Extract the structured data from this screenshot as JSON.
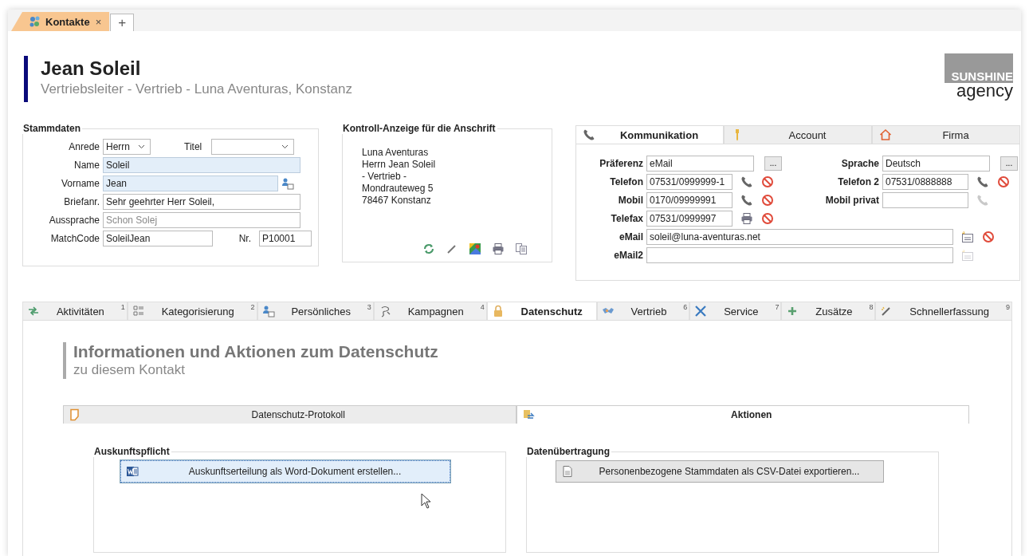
{
  "doc_tabs": [
    {
      "label": "Kontakte",
      "close": "×",
      "selected": true
    }
  ],
  "new_tab": "+",
  "header": {
    "name": "Jean Soleil",
    "subtitle": "Vertriebsleiter - Vertrieb - Luna Aventuras, Konstanz"
  },
  "logo": {
    "line1": "SUNSHINE",
    "line2": "agency"
  },
  "stammdaten": {
    "title": "Stammdaten",
    "rows": [
      [
        {
          "label": "Anrede",
          "value": "Herrn",
          "kind": "select",
          "required": false
        },
        {
          "label": "Titel",
          "kind": "select-wide",
          "required": false
        }
      ],
      [
        {
          "label": "Name",
          "value": "Soleil",
          "kind": "text",
          "required": true
        }
      ],
      [
        {
          "label": "Vorname",
          "value": "Jean",
          "kind": "with-card",
          "required": true
        }
      ],
      [
        {
          "label": "Briefanr.",
          "value": "Sehr geehrter Herr Soleil,",
          "kind": "text",
          "required": false
        }
      ],
      [
        {
          "label": "Aussprache",
          "placeholder": "Schon Solej",
          "kind": "text",
          "required": false
        }
      ],
      [
        {
          "label": "MatchCode",
          "value": "SoleilJean",
          "kind": "short",
          "required": false
        },
        {
          "label": "Nr.",
          "value": "P10001",
          "kind": "tiny",
          "required": false
        }
      ]
    ]
  },
  "anschrift": {
    "title": "Kontroll-Anzeige für die Anschrift",
    "lines": [
      "Luna Aventuras",
      "Herrn Jean Soleil",
      "- Vertrieb -",
      "Mondrauteweg 5",
      "78467 Konstanz"
    ]
  },
  "kommunikation": {
    "tabs": [
      {
        "label": "Kommunikation",
        "selected": true
      },
      {
        "label": "Account",
        "selected": false
      },
      {
        "label": "Firma",
        "selected": false
      }
    ],
    "rows": [
      [
        {
          "label": "Präferenz",
          "value": "eMail",
          "kind": "choice",
          "button": "..."
        },
        {
          "label": "Sprache",
          "value": "Deutsch",
          "kind": "choice",
          "button": "..."
        }
      ],
      [
        {
          "label": "Telefon",
          "value": "07531/0999999-1",
          "kind": "phone",
          "enabled": true
        },
        {
          "label": "Telefon 2",
          "value": "07531/0888888",
          "kind": "phone",
          "enabled": true
        }
      ],
      [
        {
          "label": "Mobil",
          "value": "0170/09999991",
          "kind": "phone",
          "enabled": true
        },
        {
          "label": "Mobil privat",
          "kind": "phone",
          "enabled": false
        }
      ],
      [
        {
          "label": "Telefax",
          "value": "07531/0999997",
          "kind": "fax",
          "enabled": true
        }
      ],
      [
        {
          "label": "eMail",
          "value": "soleil@luna-aventuras.net",
          "kind": "email",
          "enabled": true
        }
      ],
      [
        {
          "label": "eMail2",
          "kind": "email",
          "enabled": false
        }
      ]
    ]
  },
  "section_tabs": [
    {
      "label": "Aktivitäten",
      "number": "1",
      "selected": false
    },
    {
      "label": "Kategorisierung",
      "number": "2",
      "selected": false
    },
    {
      "label": "Persönliches",
      "number": "3",
      "selected": false
    },
    {
      "label": "Kampagnen",
      "number": "4",
      "selected": false
    },
    {
      "label": "Datenschutz",
      "selected": true
    },
    {
      "label": "Vertrieb",
      "number": "6",
      "selected": false
    },
    {
      "label": "Service",
      "number": "7",
      "selected": false
    },
    {
      "label": "Zusätze",
      "number": "8",
      "selected": false
    },
    {
      "label": "Schnellerfassung",
      "number": "9",
      "selected": false
    }
  ],
  "datenschutz": {
    "title": "Informationen und Aktionen zum Datenschutz",
    "subtitle": "zu diesem Kontakt",
    "tabs": [
      {
        "label": "Datenschutz-Protokoll",
        "selected": false
      },
      {
        "label": "Aktionen",
        "selected": true
      }
    ],
    "groups": [
      {
        "title": "Auskunftspflicht",
        "button": "Auskunftserteilung als Word-Dokument erstellen...",
        "focused": true
      },
      {
        "title": "Datenübertragung",
        "button": "Personenbezogene Stammdaten als CSV-Datei exportieren...",
        "focused": false
      }
    ]
  }
}
